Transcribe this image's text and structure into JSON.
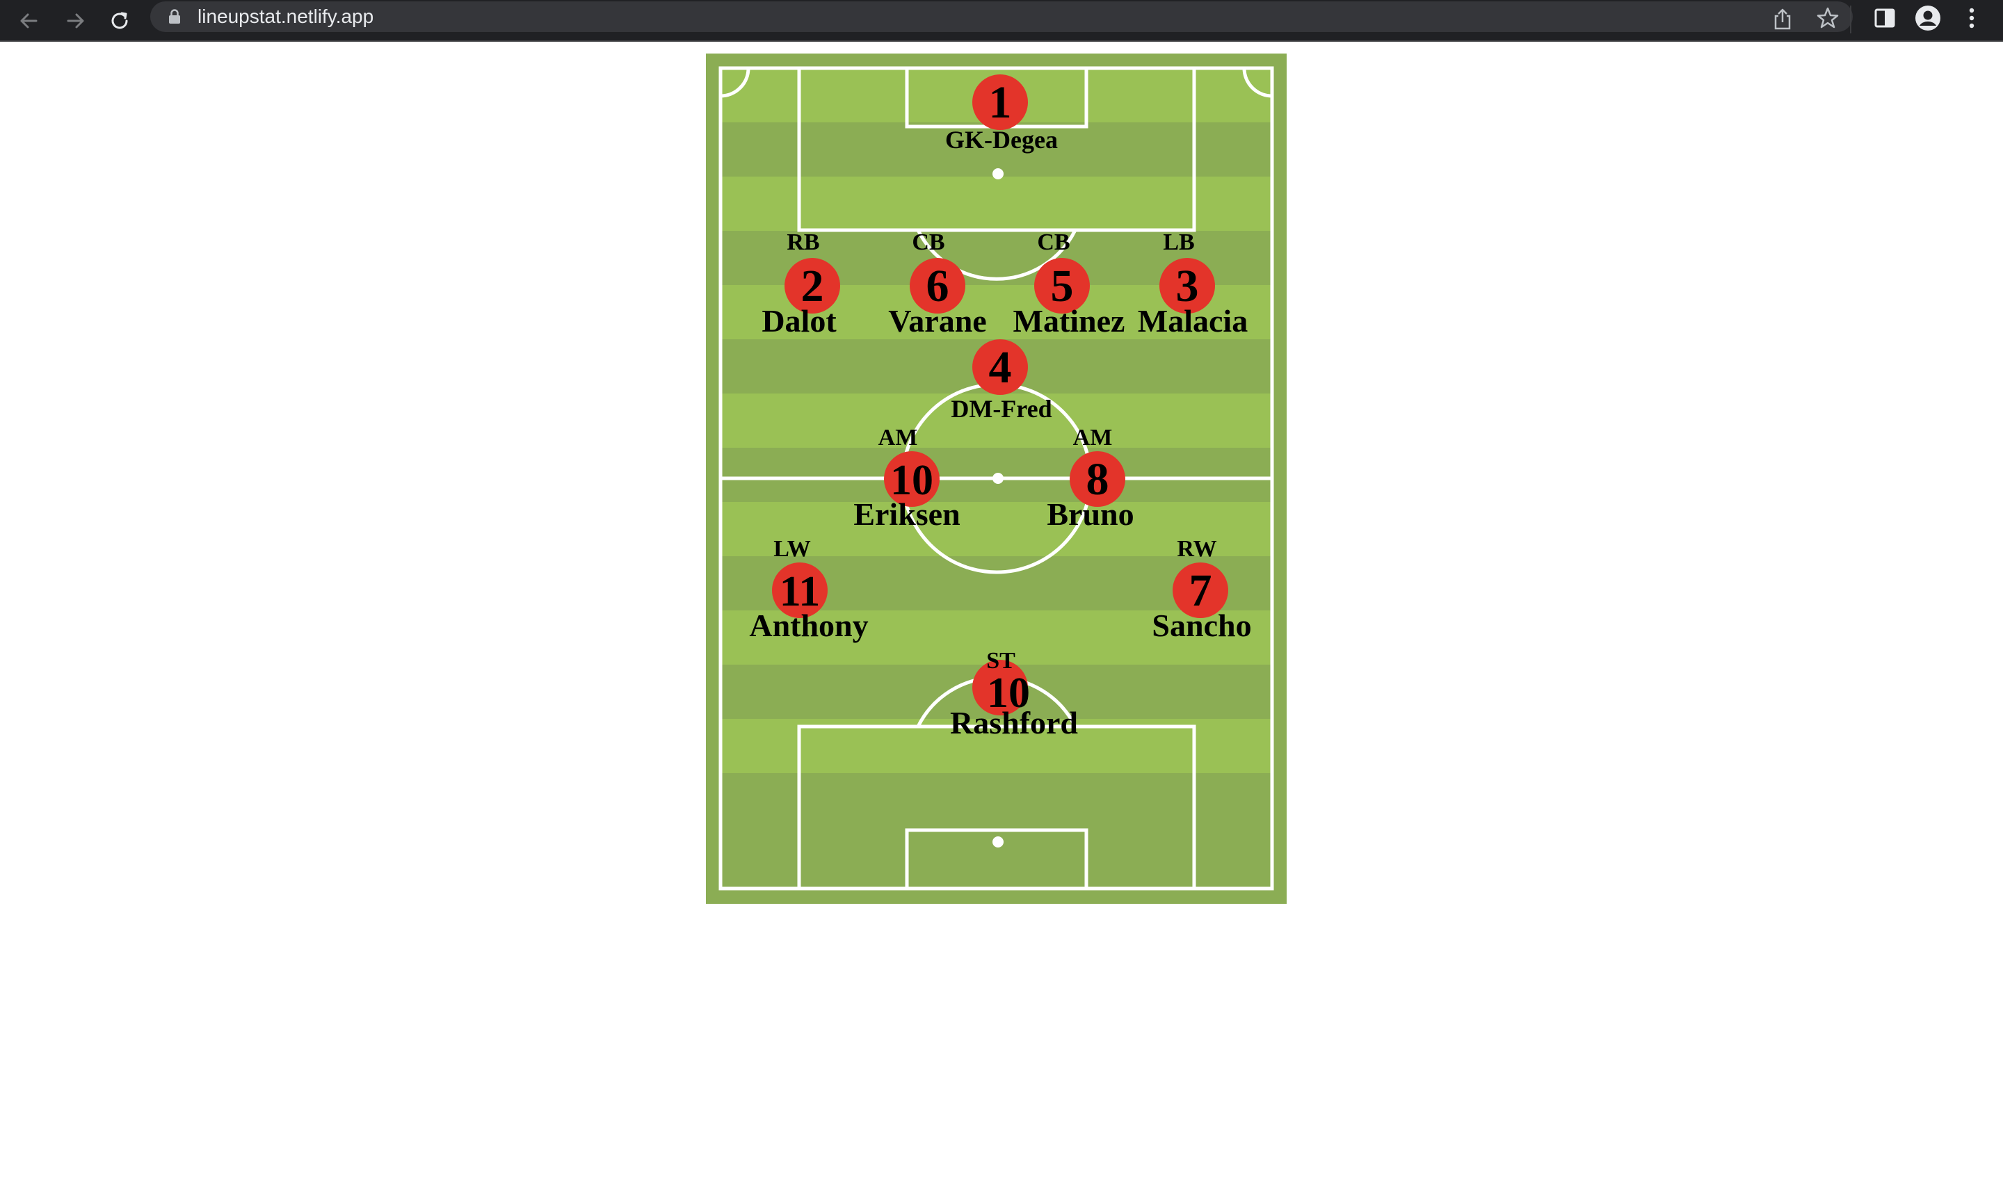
{
  "browser": {
    "url": "lineupstat.netlify.app",
    "icons": [
      "back-arrow-icon",
      "forward-arrow-icon",
      "reload-icon",
      "lock-icon",
      "share-icon",
      "star-icon",
      "side-panel-icon",
      "profile-icon",
      "kebab-menu-icon"
    ]
  },
  "colors": {
    "chrome_bg": "#202124",
    "omnibox_bg": "#35363a",
    "pitch_dark": "#8bad54",
    "pitch_light": "#9ac155",
    "marker": "#e3342a",
    "lines": "#ffffff"
  },
  "lineup": {
    "players": [
      {
        "id": "gk",
        "position": "GK",
        "number": "1",
        "name": "GK-Degea"
      },
      {
        "id": "rb",
        "position": "RB",
        "number": "2",
        "name": "Dalot"
      },
      {
        "id": "cb1",
        "position": "CB",
        "number": "6",
        "name": "Varane"
      },
      {
        "id": "cb2",
        "position": "CB",
        "number": "5",
        "name": "Matinez"
      },
      {
        "id": "lb",
        "position": "LB",
        "number": "3",
        "name": "Malacia"
      },
      {
        "id": "dm",
        "position": "DM",
        "number": "4",
        "name": "DM-Fred"
      },
      {
        "id": "am1",
        "position": "AM",
        "number": "10",
        "name": "Eriksen"
      },
      {
        "id": "am2",
        "position": "AM",
        "number": "8",
        "name": "Bruno"
      },
      {
        "id": "lw",
        "position": "LW",
        "number": "11",
        "name": "Anthony"
      },
      {
        "id": "rw",
        "position": "RW",
        "number": "7",
        "name": "Sancho"
      },
      {
        "id": "st",
        "position": "ST",
        "number": "10",
        "name": "Rashford"
      }
    ]
  }
}
